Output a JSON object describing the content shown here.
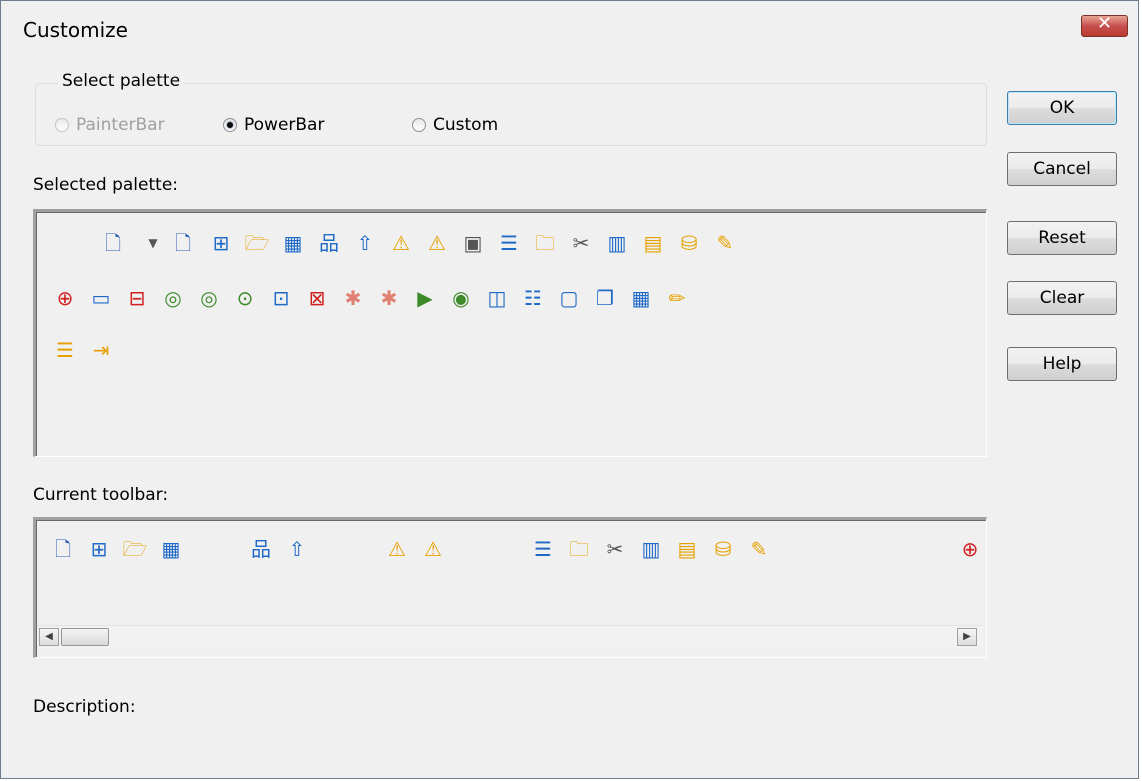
{
  "window": {
    "title": "Customize"
  },
  "select_palette": {
    "label": "Select palette",
    "options": [
      {
        "label": "PainterBar",
        "state": "disabled"
      },
      {
        "label": "PowerBar",
        "state": "selected"
      },
      {
        "label": "Custom",
        "state": "unselected"
      }
    ]
  },
  "selected_palette": {
    "label": "Selected palette:",
    "icons": [
      "new-icon",
      "dropdown-arrow-icon",
      "new-icon",
      "inherit-icon",
      "open-folder-icon",
      "run-window-icon",
      "library-icon",
      "export-icon",
      "regenerate-icon",
      "check-in-icon",
      "properties-icon",
      "list-icon",
      "search-folder-icon",
      "cut-icon",
      "chart-icon",
      "database-table-icon",
      "database-icon",
      "edit-icon",
      "debug-add-icon",
      "monitor-icon",
      "debug-remove-icon",
      "profile-icon",
      "trace-icon",
      "search-icon",
      "skip-icon",
      "stop-icon",
      "bug-icon",
      "bug-step-icon",
      "run-icon",
      "run-to-icon",
      "columns-icon",
      "rows-icon",
      "window-icon",
      "cascade-icon",
      "layout-icon",
      "pencil-icon",
      "list-document-icon",
      "exit-icon"
    ]
  },
  "current_toolbar": {
    "label": "Current toolbar:",
    "icons": [
      "new-icon",
      "inherit-icon",
      "open-folder-icon",
      "run-window-icon",
      "library-icon",
      "export-icon",
      "regenerate-icon",
      "check-in-icon",
      "list-icon",
      "search-folder-icon",
      "cut-icon",
      "chart-icon",
      "database-table-icon",
      "database-icon",
      "edit-icon",
      "debug-add-icon"
    ]
  },
  "description": {
    "label": "Description:"
  },
  "buttons": {
    "ok": "OK",
    "cancel": "Cancel",
    "reset": "Reset",
    "clear": "Clear",
    "help": "Help"
  }
}
